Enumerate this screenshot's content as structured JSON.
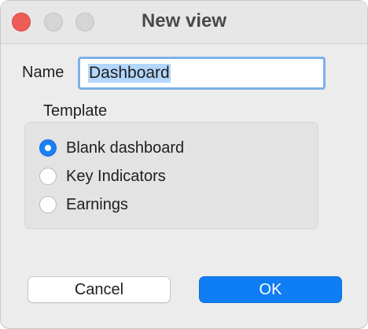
{
  "window": {
    "title": "New view",
    "controls": [
      "close-icon",
      "minimize-icon",
      "zoom-icon"
    ]
  },
  "form": {
    "name_label": "Name",
    "name_value": "Dashboard",
    "template_label": "Template",
    "template_options": [
      {
        "label": "Blank dashboard",
        "selected": true
      },
      {
        "label": "Key Indicators",
        "selected": false
      },
      {
        "label": "Earnings",
        "selected": false
      }
    ]
  },
  "buttons": {
    "cancel": "Cancel",
    "ok": "OK"
  },
  "colors": {
    "accent": "#0f7df3",
    "close": "#ee5d55",
    "selection": "#b3d6fc",
    "focus_ring": "#7fb0ea"
  }
}
